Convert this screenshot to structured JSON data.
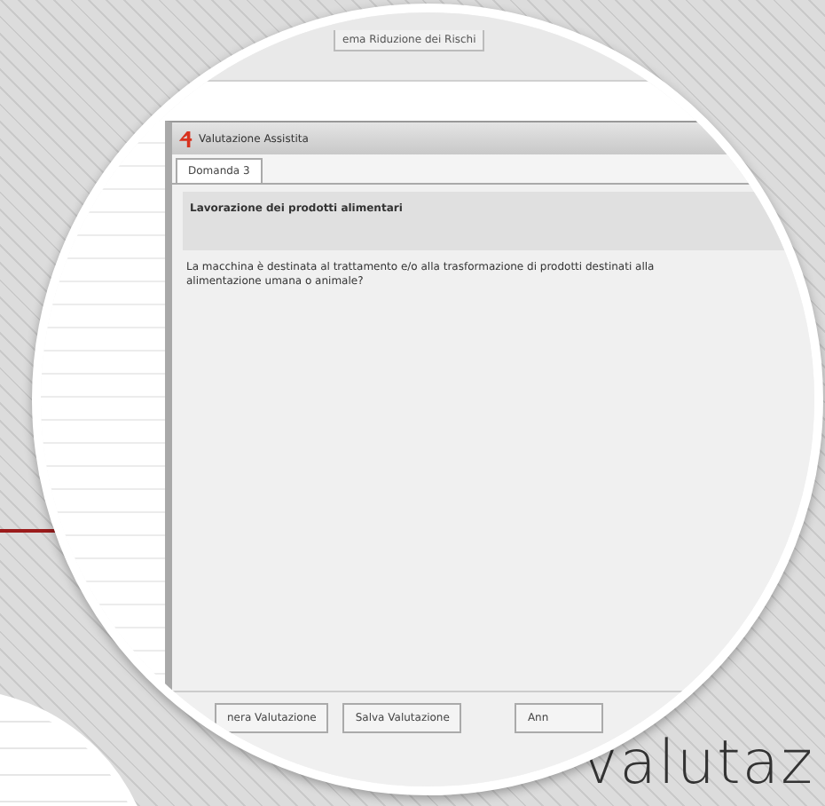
{
  "background_app": {
    "tab": "ema Riduzione dei Rischi"
  },
  "window": {
    "title": "Valutazione Assistita",
    "tabs": [
      {
        "label": "Domanda 3",
        "selected": true
      }
    ],
    "heading": "Lavorazione dei prodotti alimentari",
    "question": "La macchina è destinata al trattamento e/o alla trasformazione di prodotti destinati alla alimentazione umana o animale?",
    "buttons": [
      "nera Valutazione",
      "Salva Valutazione",
      "Ann"
    ]
  },
  "slide_text": "valutaz"
}
